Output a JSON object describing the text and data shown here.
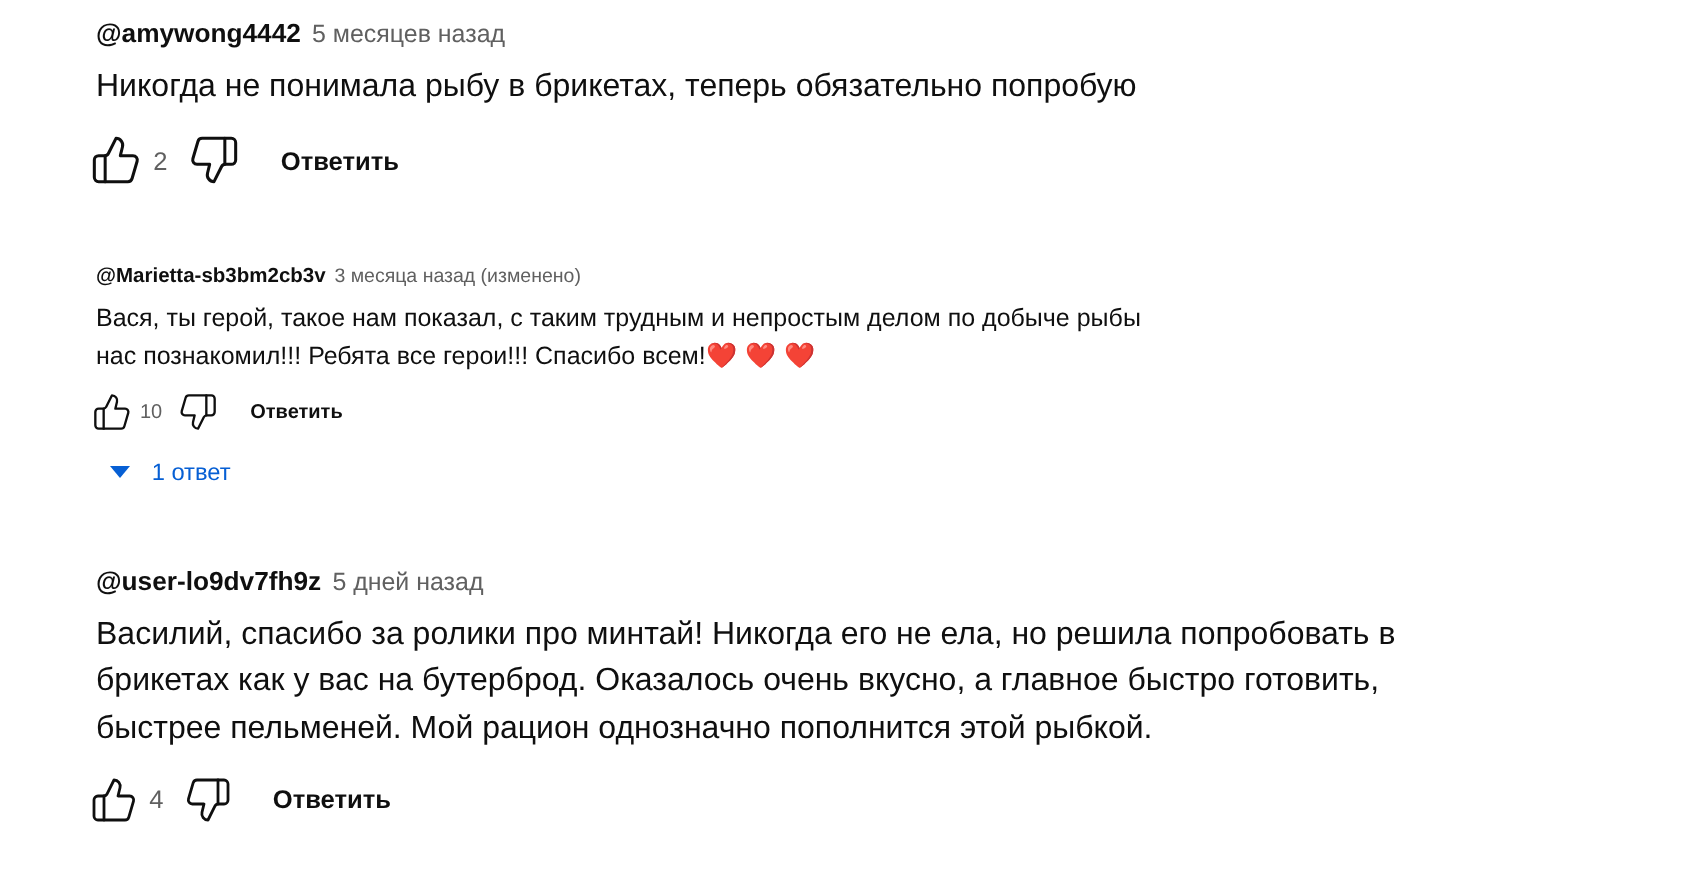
{
  "comments": [
    {
      "author": "@amywong4442",
      "time": "5 месяцев назад",
      "text": "Никогда не понимала рыбу в брикетах, теперь обязательно попробую",
      "likes": "2",
      "reply_button": "Ответить"
    },
    {
      "author": "@Marietta-sb3bm2cb3v",
      "time": "3 месяца назад (изменено)",
      "text": "Вася, ты герой, такое нам показал, с таким трудным и непростым делом по добыче рыбы\nнас познакомил!!! Ребята все герои!!! Спасибо всем!",
      "emoji": "❤️ ❤️ ❤️",
      "likes": "10",
      "reply_button": "Ответить",
      "replies": "1 ответ"
    },
    {
      "author": "@user-lo9dv7fh9z",
      "time": "5 дней назад",
      "text": "Василий, спасибо за ролики про минтай! Никогда его не ела, но решила попробовать в\nбрикетах как у вас на бутерброд. Оказалось очень вкусно, а главное быстро готовить,\nбыстрее пельменей. Мой рацион однозначно пополнится этой рыбкой.",
      "likes": "4",
      "reply_button": "Ответить"
    }
  ]
}
